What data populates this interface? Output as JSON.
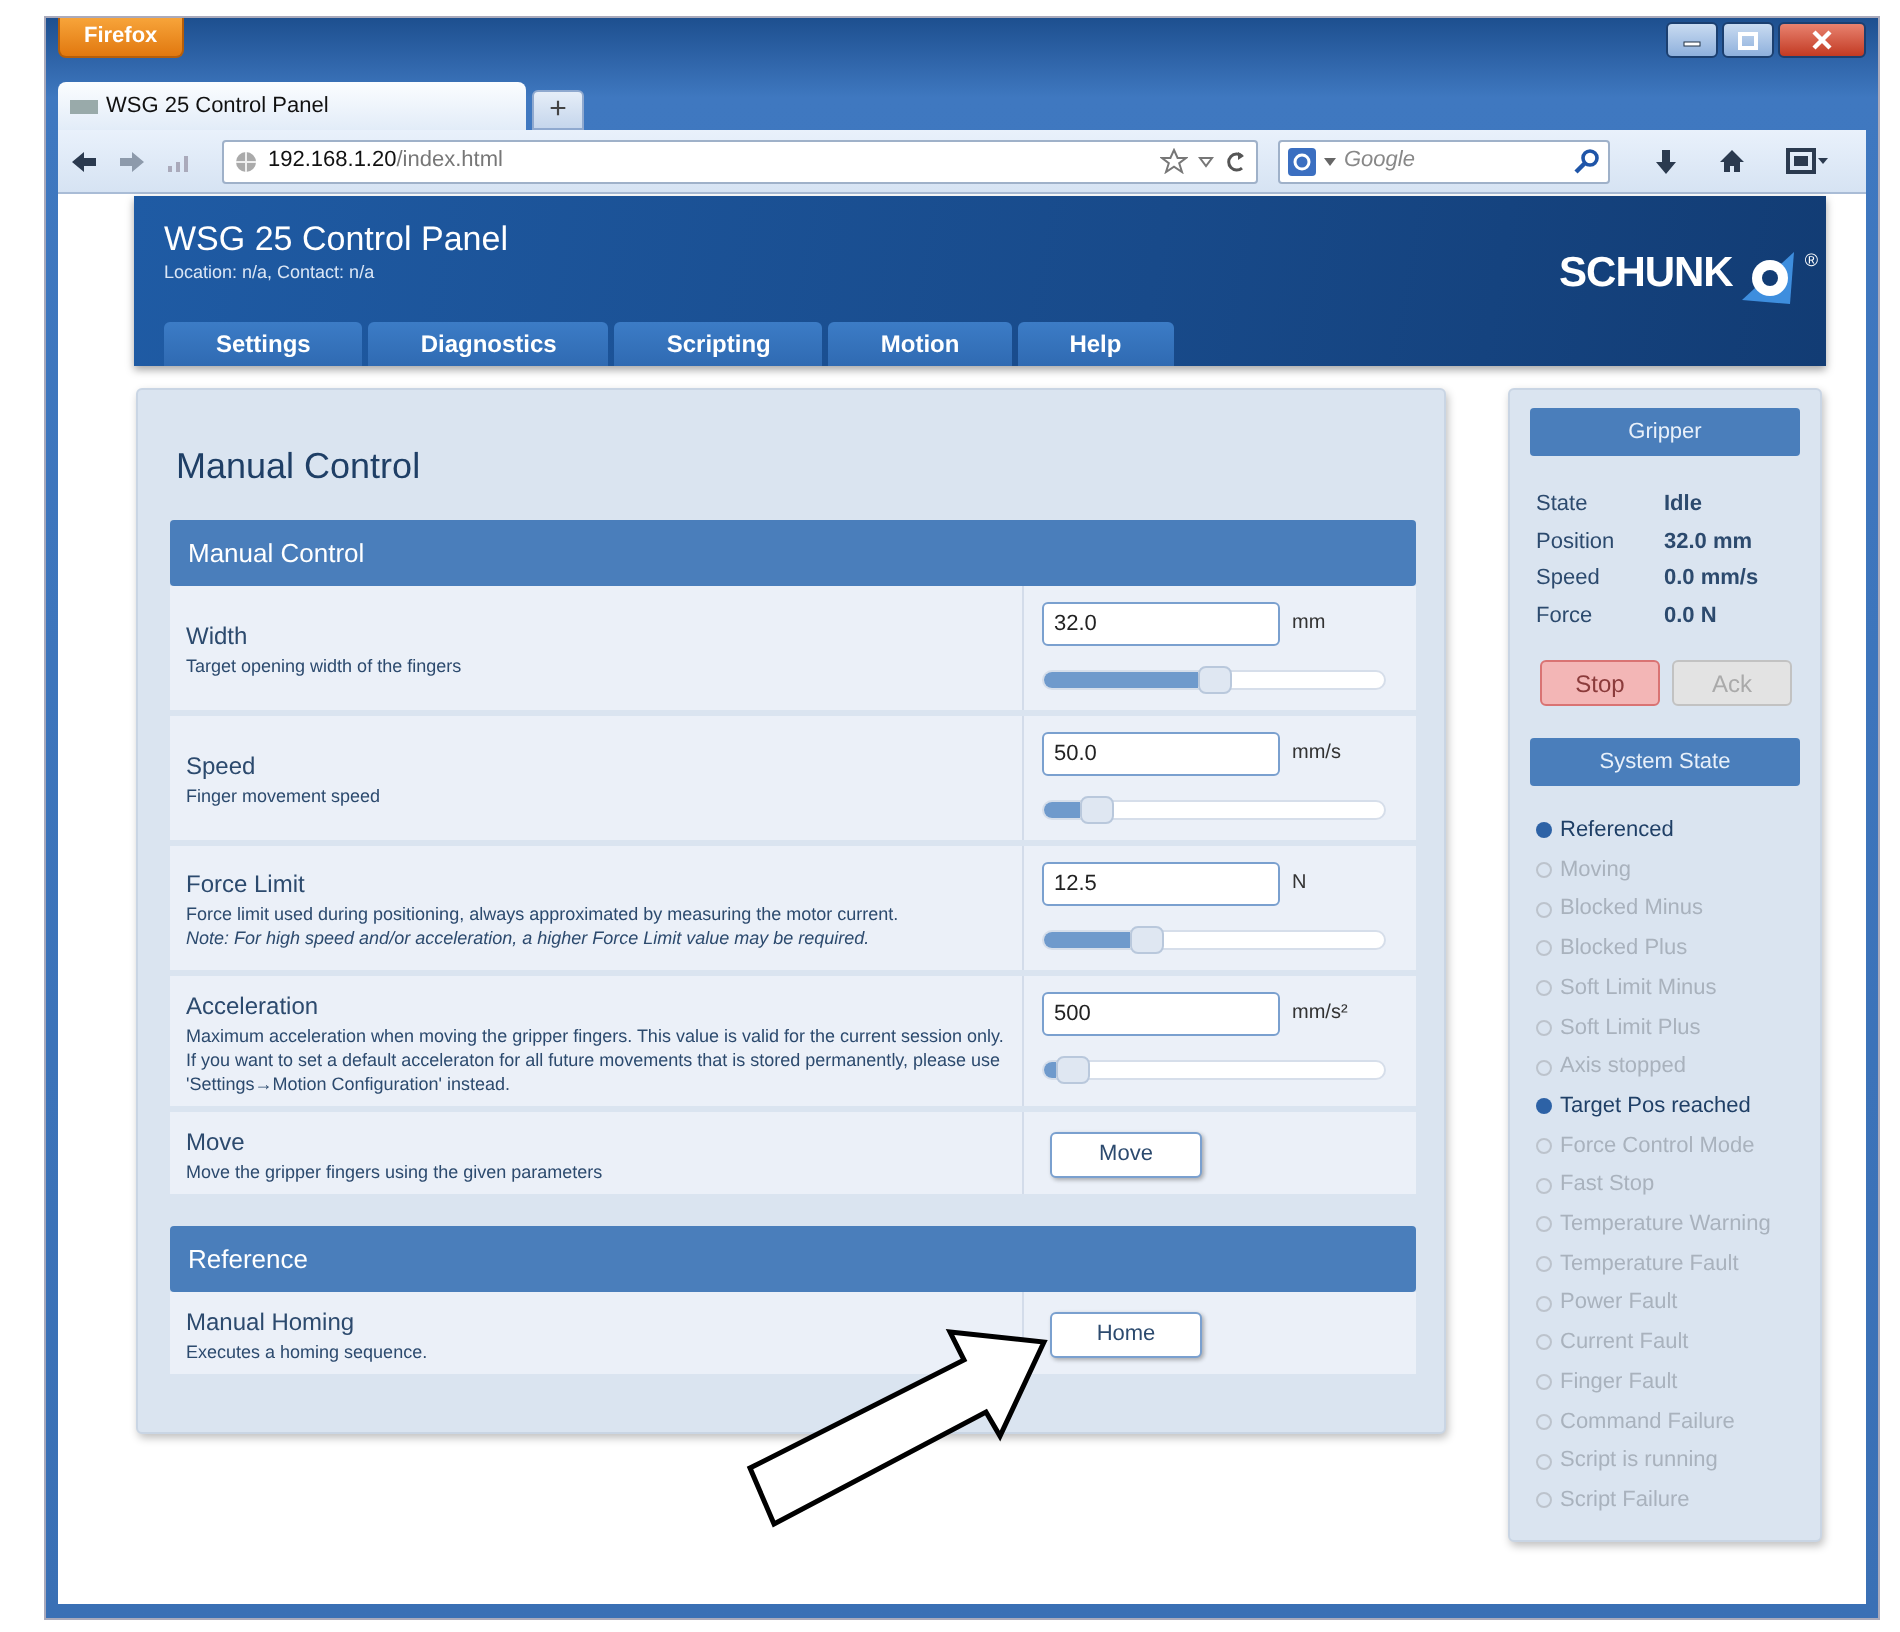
{
  "browser": {
    "menu_button": "Firefox",
    "tab_title": "WSG 25 Control Panel",
    "new_tab": "+",
    "url_host": "192.168.1.20",
    "url_path": "/index.html",
    "search_placeholder": "Google"
  },
  "header": {
    "title": "WSG 25 Control Panel",
    "subtitle": "Location: n/a, Contact: n/a",
    "logo": "SCHUNK",
    "logo_mark": "®"
  },
  "nav": [
    "Settings",
    "Diagnostics",
    "Scripting",
    "Motion",
    "Help"
  ],
  "main": {
    "title": "Manual Control",
    "sections": [
      {
        "heading": "Manual Control",
        "rows": [
          {
            "kind": "slider",
            "label": "Width",
            "description": "Target opening width of the fingers",
            "value": "32.0",
            "unit": "mm",
            "level": 0.5
          },
          {
            "kind": "slider",
            "label": "Speed",
            "description": "Finger movement speed",
            "value": "50.0",
            "unit": "mm/s",
            "level": 0.15
          },
          {
            "kind": "slider",
            "label": "Force Limit",
            "description": "Force limit used during positioning, always approximated by measuring the motor current.",
            "note": "Note: For high speed and/or acceleration, a higher Force Limit value may be required.",
            "value": "12.5",
            "unit": "N",
            "level": 0.3
          },
          {
            "kind": "slider",
            "label": "Acceleration",
            "description": "Maximum acceleration when moving the gripper fingers. This value is valid for the current session only. If you want to set a default acceleraton for all future movements that is stored permanently, please use 'Settings→Motion Configuration' instead.",
            "value": "500",
            "unit": "mm/s²",
            "level": 0.08
          },
          {
            "kind": "button",
            "label": "Move",
            "description": "Move the gripper fingers using the given parameters",
            "button": "Move"
          }
        ]
      },
      {
        "heading": "Reference",
        "rows": [
          {
            "kind": "button",
            "label": "Manual Homing",
            "description": "Executes a homing sequence.",
            "button": "Home"
          }
        ]
      }
    ]
  },
  "sidebar": {
    "gripper_heading": "Gripper",
    "stats": [
      {
        "label": "State",
        "value": "Idle"
      },
      {
        "label": "Position",
        "value": "32.0 mm"
      },
      {
        "label": "Speed",
        "value": "0.0 mm/s"
      },
      {
        "label": "Force",
        "value": "0.0 N"
      }
    ],
    "buttons": [
      {
        "label": "Stop",
        "kind": "stop",
        "disabled": false
      },
      {
        "label": "Ack",
        "kind": "ack",
        "disabled": true
      }
    ],
    "system_heading": "System State",
    "flags": [
      {
        "label": "Referenced",
        "on": true
      },
      {
        "label": "Moving",
        "on": false
      },
      {
        "label": "Blocked Minus",
        "on": false
      },
      {
        "label": "Blocked Plus",
        "on": false
      },
      {
        "label": "Soft Limit Minus",
        "on": false
      },
      {
        "label": "Soft Limit Plus",
        "on": false
      },
      {
        "label": "Axis stopped",
        "on": false
      },
      {
        "label": "Target Pos reached",
        "on": true
      },
      {
        "label": "Force Control Mode",
        "on": false
      },
      {
        "label": "Fast Stop",
        "on": false
      },
      {
        "label": "Temperature Warning",
        "on": false
      },
      {
        "label": "Temperature Fault",
        "on": false
      },
      {
        "label": "Power Fault",
        "on": false
      },
      {
        "label": "Current Fault",
        "on": false
      },
      {
        "label": "Finger Fault",
        "on": false
      },
      {
        "label": "Command Failure",
        "on": false
      },
      {
        "label": "Script is running",
        "on": false
      },
      {
        "label": "Script Failure",
        "on": false
      }
    ]
  }
}
